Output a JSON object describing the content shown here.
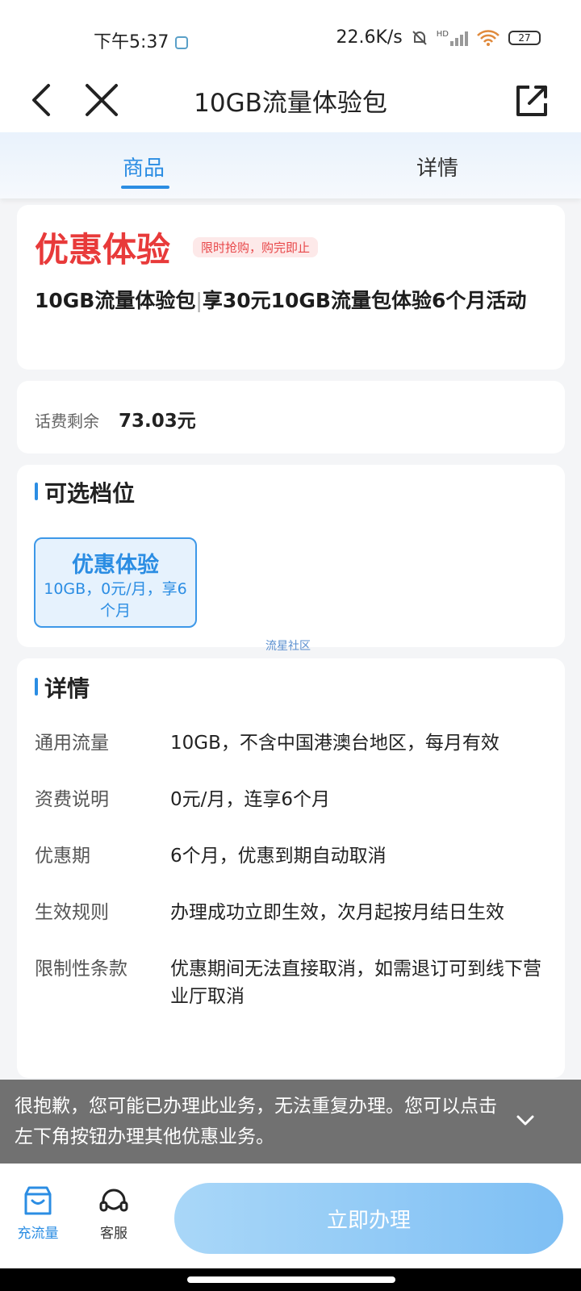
{
  "status_bar": {
    "time": "下午5:37",
    "speed": "22.6K/s",
    "hd_label": "HD",
    "battery": "27"
  },
  "navbar": {
    "title": "10GB流量体验包"
  },
  "tabs": [
    {
      "label": "商品",
      "active": true
    },
    {
      "label": "详情",
      "active": false
    }
  ],
  "promo": {
    "title": "优惠体验",
    "badge": "限时抢购，购完即止",
    "desc_name": "10GB流量体验包",
    "desc_separator": "|",
    "desc_detail": "享30元10GB流量包体验6个月活动"
  },
  "balance": {
    "label": "话费剩余",
    "value": "73.03元"
  },
  "tiers": {
    "section_title": "可选档位",
    "options": [
      {
        "name": "优惠体验",
        "desc": "10GB，0元/月，享6个月",
        "selected": true
      }
    ],
    "watermark": "流星社区"
  },
  "details": {
    "section_title": "详情",
    "rows": [
      {
        "label": "通用流量",
        "value": "10GB，不含中国港澳台地区，每月有效"
      },
      {
        "label": "资费说明",
        "value": "0元/月，连享6个月"
      },
      {
        "label": "优惠期",
        "value": "6个月，优惠到期自动取消"
      },
      {
        "label": "生效规则",
        "value": "办理成功立即生效，次月起按月结日生效"
      },
      {
        "label": "限制性条款",
        "value": "优惠期间无法直接取消，如需退订可到线下营业厅取消"
      }
    ]
  },
  "toast": {
    "message": "很抱歉，您可能已办理此业务，无法重复办理。您可以点击左下角按钮办理其他优惠业务。"
  },
  "bottom_bar": {
    "recharge_label": "充流量",
    "service_label": "客服",
    "cta_label": "立即办理"
  },
  "colors": {
    "accent": "#2b8de3",
    "promo_red": "#e83a3a",
    "cta_start": "#a9d7f8",
    "cta_end": "#7ebff4",
    "toast_bg": "#6c6c6c"
  },
  "icons": {
    "back": "chevron-left-icon",
    "close": "close-icon",
    "share": "share-icon",
    "recharge": "shop-icon",
    "service": "headset-icon",
    "toast_toggle": "chevron-down-icon"
  }
}
